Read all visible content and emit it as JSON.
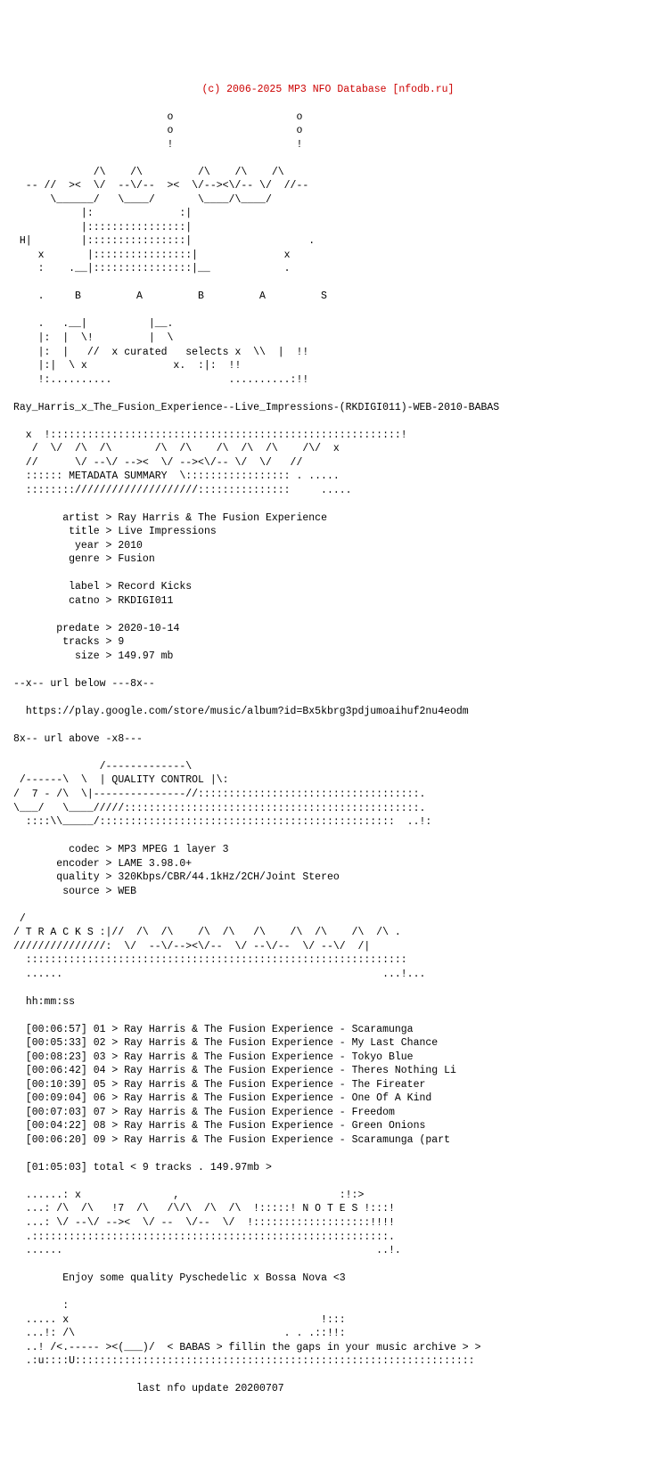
{
  "header": {
    "copyright": "(c) 2006-2025 MP3 NFO Database [nfodb.ru]"
  },
  "ascii_art": {
    "logo": "                         o                    o\n                         o                    o\n                         !                    !\n\n             /\\    /\\         /\\    /\\    /\\\n  -- //  ><  \\/  --\\/--  ><  \\/--><\\/-- \\/  //--\n      \\______/   \\____/       \\____/\\____/\n           |:              :|           \n           |::::::::::::::::|           \n H|        |::::::::::::::::|                   .\n    x       |::::::::::::::::|              x\n    :    .__|::::::::::::::::|__            .\n\n    .     B         A         B         A         S\n\n    .   .__|          |__.\n    |:  |  \\!         |  \\\n    |:  |   //  x curated   selects x  \\\\  |  !!\n    |:|  \\ x              x.  :|:  !!\n    !:..........                   ..........:!!",
    "release_name": "Ray_Harris_x_The_Fusion_Experience--Live_Impressions-(RKDIGI011)-WEB-2010-BABAS",
    "metadata_box": "  x  !:::::::::::::::::::::::::::::::::::::::::::::::::::::::::!\n   /  \\/  /\\  /\\       /\\  /\\    /\\  /\\  /\\    /\\/  x\n  //      \\/ --\\/ --><  \\/ --><\\/-- \\/  \\/   //\n  :::::: METADATA SUMMARY  \\::::::::::::::::: . .....\n  ::::::::////////////////////:::::::::::::::     .....",
    "quality_box": "              /-------------\\\n /------\\  \\  | QUALITY CONTROL |\\:\n/  7 - /\\  \\|---------------//:::::::::::::::::::::::::::::::::::.\n\\___/   \\____/////::::::::::::::::::::::::::::::::::::::::::::::::\n  ::::\\_____/::::::::::::::::::::::::::::::::::::::::::::::::  ..!:",
    "tracks_box": " /                                                              \n/ T R A C K S :|//  /\\  /\\    /\\  /\\   /\\    /\\  /\\    /\\  /\\ .\n///////////////:  \\/  --\\/--><\\/--  \\/ --\\/--  \\/ --\\/  /|\n  ::::::::::::::::::::::::::::::::::::::::::::::::::::::::::::::\n  ......                                                    ...!...",
    "notes_box": "  ......: x               ,                          :!:>\n  ...: /\\  /\\   !7  /\\   /\\/\\  /\\  /\\  !:::::! N O T E S !:::!\n  ...: \\/ --\\/ --><  \\/ --  \\/--  \\/  !:::::::::::::::::::!!!!\n  .::::::::::::::::::::::::::::::::::::::::::::::::::::::::::\n  ......                                                   ..!.",
    "footer_box": "        :\n  ..... x                                         !:::\n  ...!: /\\                                  . . .::!!:\n  ..! /<.----- ><(___)/  < BABAS > fillin the gaps in your music archive > >\n  .:u::::U:::::::::::::::::::::::::::::::::::::::::::::::::::::::::::::::::"
  },
  "metadata": {
    "artist": "Ray Harris & The Fusion Experience",
    "title": "Live Impressions",
    "year": "2010",
    "genre": "Fusion",
    "label": "Record Kicks",
    "catno": "RKDIGI011",
    "predate": "2020-10-14",
    "tracks": "9",
    "size": "149.97 mb"
  },
  "url_section": {
    "label_above": "--x-- url below ---8x--",
    "url": "https://play.google.com/store/music/album?id=Bx5kbrg3pdjumoaihuf2nu4eodm",
    "label_below": "8x-- url above -x8---"
  },
  "quality": {
    "codec": "MP3 MPEG 1 layer 3",
    "encoder": "LAME 3.98.0+",
    "quality": "320Kbps/CBR/44.1kHz/2CH/Joint Stereo",
    "source": "WEB"
  },
  "tracks": {
    "header": "hh:mm:ss",
    "list": [
      "[00:06:57] 01 > Ray Harris & The Fusion Experience - Scaramunga",
      "[00:05:33] 02 > Ray Harris & The Fusion Experience - My Last Chance",
      "[00:08:23] 03 > Ray Harris & The Fusion Experience - Tokyo Blue",
      "[00:06:42] 04 > Ray Harris & The Fusion Experience - Theres Nothing Li",
      "[00:10:39] 05 > Ray Harris & The Fusion Experience - The Fireater",
      "[00:09:04] 06 > Ray Harris & The Fusion Experience - One Of A Kind",
      "[00:07:03] 07 > Ray Harris & The Fusion Experience - Freedom",
      "[00:04:22] 08 > Ray Harris & The Fusion Experience - Green Onions",
      "[00:06:20] 09 > Ray Harris & The Fusion Experience - Scaramunga (part"
    ],
    "total": "[01:05:03] total < 9 tracks . 149.97mb >"
  },
  "notes": {
    "text": "Enjoy some quality Pyschedelic x Bossa Nova <3"
  },
  "footer": {
    "last_update": "last nfo update 20200707"
  }
}
